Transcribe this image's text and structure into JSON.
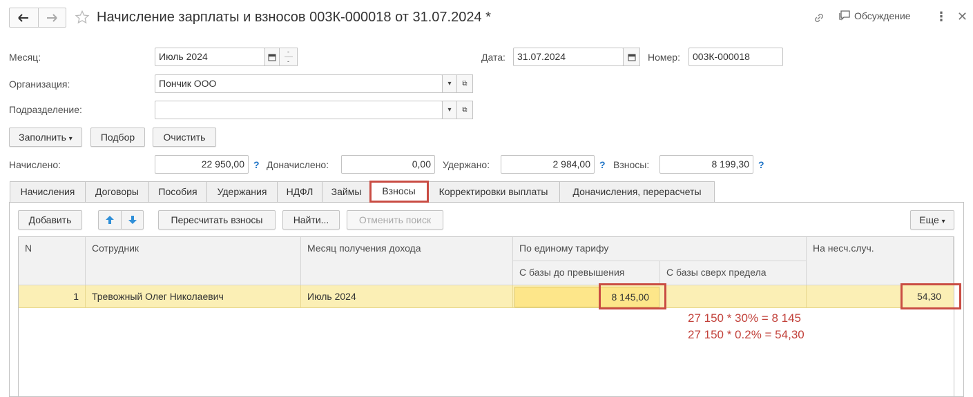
{
  "header": {
    "title": "Начисление зарплаты и взносов 003К-000018 от 31.07.2024 *",
    "discussion_label": "Обсуждение",
    "more_icon": "more-vertical-icon",
    "close_icon": "close-icon"
  },
  "form": {
    "month_label": "Месяц:",
    "month_value": "Июль 2024",
    "date_label": "Дата:",
    "date_value": "31.07.2024",
    "number_label": "Номер:",
    "number_value": "003К-000018",
    "org_label": "Организация:",
    "org_value": "Пончик ООО",
    "dept_label": "Подразделение:",
    "dept_value": ""
  },
  "actions": {
    "fill_label": "Заполнить",
    "select_label": "Подбор",
    "clear_label": "Очистить"
  },
  "totals": {
    "accrued_label": "Начислено:",
    "accrued_value": "22 950,00",
    "additional_label": "Доначислено:",
    "additional_value": "0,00",
    "withheld_label": "Удержано:",
    "withheld_value": "2 984,00",
    "contributions_label": "Взносы:",
    "contributions_value": "8 199,30",
    "help": "?"
  },
  "tabs": [
    "Начисления",
    "Договоры",
    "Пособия",
    "Удержания",
    "НДФЛ",
    "Займы",
    "Взносы",
    "Корректировки выплаты",
    "Доначисления, перерасчеты"
  ],
  "toolbar": {
    "add_label": "Добавить",
    "recalc_label": "Пересчитать взносы",
    "find_label": "Найти...",
    "cancel_search_label": "Отменить поиск",
    "more_label": "Еще"
  },
  "table": {
    "col_n": "N",
    "col_employee": "Сотрудник",
    "col_month": "Месяц получения дохода",
    "col_unified": "По единому тарифу",
    "col_base_below": "С базы до превышения",
    "col_base_above": "С базы сверх предела",
    "col_accident": "На несч.случ.",
    "rows": [
      {
        "n": "1",
        "employee": "Тревожный Олег Николаевич",
        "month": "Июль 2024",
        "base_below": "8 145,00",
        "base_above": "",
        "accident": "54,30"
      }
    ]
  },
  "annotations": {
    "line1": "27 150 * 30% = 8 145",
    "line2": "27 150 * 0.2% = 54,30"
  },
  "colors": {
    "highlight": "#c94c43",
    "row_selected": "#fbefb5",
    "help": "#1f74c6"
  }
}
